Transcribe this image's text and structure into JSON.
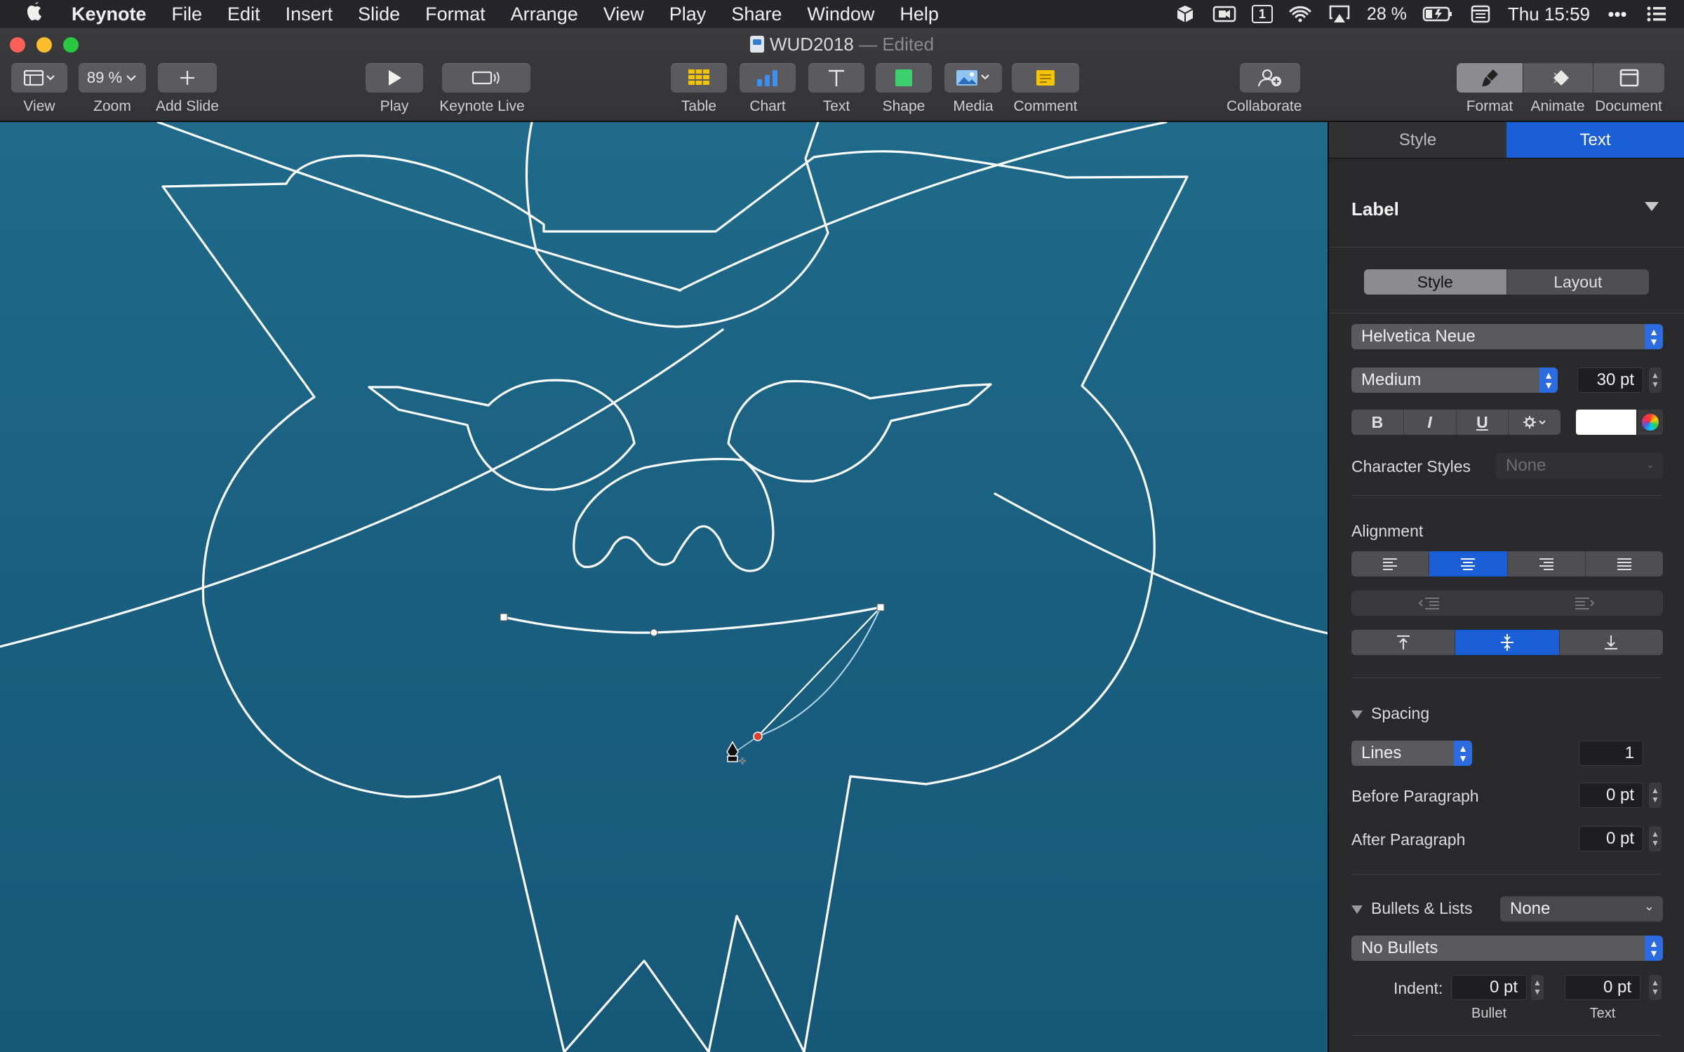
{
  "menubar": {
    "apple_icon": "apple-logo-icon",
    "app_name": "Keynote",
    "items": [
      "File",
      "Edit",
      "Insert",
      "Slide",
      "Format",
      "Arrange",
      "View",
      "Play",
      "Share",
      "Window",
      "Help"
    ],
    "battery": "28 %",
    "clock": "Thu 15:59",
    "display_badge": "1"
  },
  "window": {
    "title": "WUD2018",
    "title_suffix": " — Edited"
  },
  "toolbar": {
    "view_label": "View",
    "zoom_value": "89 %",
    "zoom_label": "Zoom",
    "add_slide_label": "Add Slide",
    "play_label": "Play",
    "keynote_live_label": "Keynote Live",
    "table_label": "Table",
    "chart_label": "Chart",
    "text_label": "Text",
    "shape_label": "Shape",
    "media_label": "Media",
    "comment_label": "Comment",
    "collaborate_label": "Collaborate",
    "format_label": "Format",
    "animate_label": "Animate",
    "document_label": "Document"
  },
  "inspector": {
    "tabs": [
      "Style",
      "Text"
    ],
    "active_tab": "Text",
    "paragraph_style": "Label",
    "subtabs": [
      "Style",
      "Layout"
    ],
    "font_family": "Helvetica Neue",
    "font_weight": "Medium",
    "font_size": "30 pt",
    "format_buttons": [
      "B",
      "I",
      "U"
    ],
    "character_styles_label": "Character Styles",
    "character_styles_value": "None",
    "alignment_label": "Alignment",
    "spacing_label": "Spacing",
    "spacing_mode": "Lines",
    "spacing_value": "1",
    "before_paragraph_label": "Before Paragraph",
    "before_paragraph_value": "0 pt",
    "after_paragraph_label": "After Paragraph",
    "after_paragraph_value": "0 pt",
    "bullets_label": "Bullets & Lists",
    "bullets_value": "None",
    "bullet_type": "No Bullets",
    "indent_label": "Indent:",
    "indent_bullet_value": "0 pt",
    "indent_text_value": "0 pt",
    "indent_bullet_label": "Bullet",
    "indent_text_label": "Text"
  },
  "colors": {
    "accent": "#1a5fd6",
    "canvas": "#1a6183",
    "anchor_point": "#e0402a"
  }
}
